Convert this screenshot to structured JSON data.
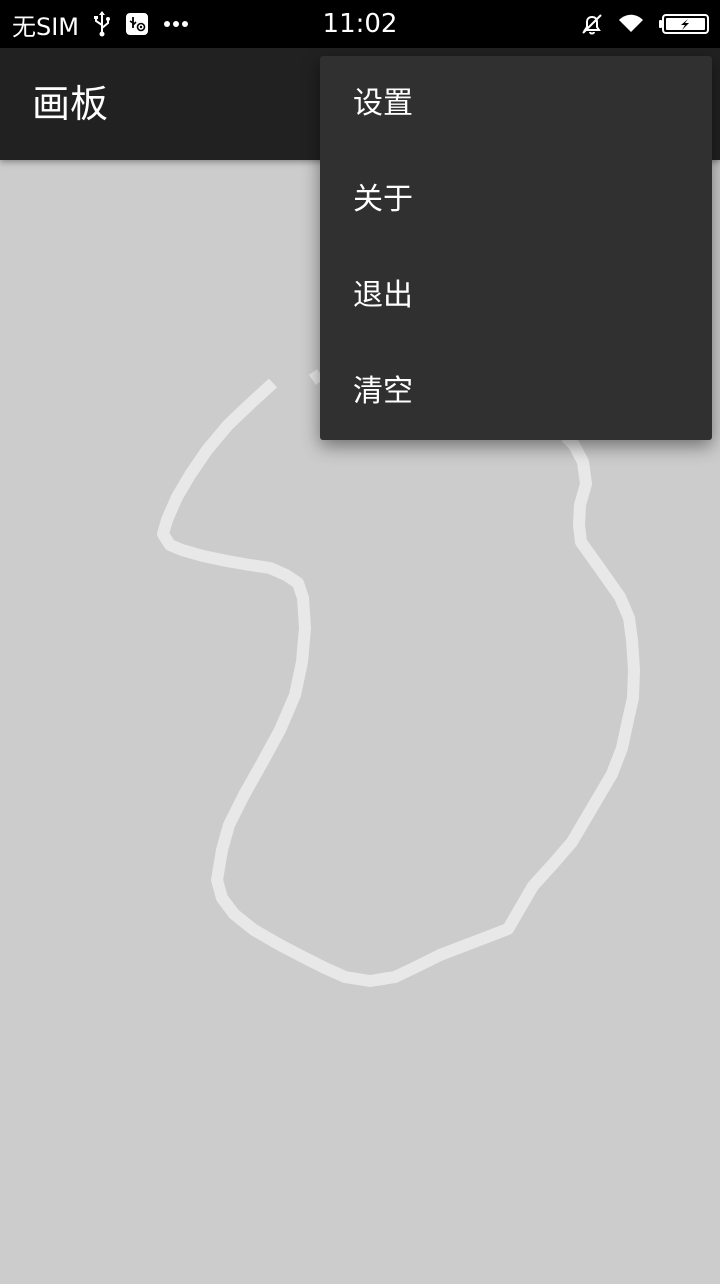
{
  "status_bar": {
    "carrier": "无SIM",
    "time": "11:02",
    "icons_left": [
      "usb-icon",
      "usb-debug-icon",
      "more-dots-icon"
    ],
    "icons_right": [
      "mute-bell-icon",
      "wifi-icon",
      "battery-charging-icon"
    ]
  },
  "app_bar": {
    "title": "画板"
  },
  "menu": {
    "items": [
      {
        "label": "设置"
      },
      {
        "label": "关于"
      },
      {
        "label": "退出"
      },
      {
        "label": "清空"
      }
    ]
  },
  "colors": {
    "status_bar": "#000000",
    "app_bar": "#212121",
    "canvas_background": "#cccccc",
    "stroke": "#e8e8e8",
    "menu_background": "#303030",
    "text": "#ffffff"
  }
}
